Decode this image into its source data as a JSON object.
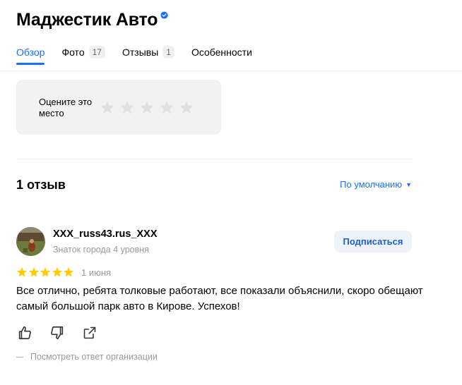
{
  "header": {
    "title": "Маджестик Авто",
    "verified_icon": "verified-badge-icon"
  },
  "tabs": [
    {
      "label": "Обзор",
      "count": null,
      "active": true
    },
    {
      "label": "Фото",
      "count": "17"
    },
    {
      "label": "Отзывы",
      "count": "1"
    },
    {
      "label": "Особенности",
      "count": null
    }
  ],
  "rate": {
    "label": "Оцените это место",
    "stars": 5
  },
  "reviews": {
    "count_label": "1 отзыв",
    "sort_label": "По умолчанию",
    "items": [
      {
        "author": "XXX_russ43.rus_XXX",
        "level": "Знаток города 4 уровня",
        "subscribe_label": "Подписаться",
        "rating": 5,
        "date": "1 июня",
        "text": "Все отлично, ребята толковые работают, все показали объяснили, скоро обещают самый большой парк авто в Кирове. Успехов!",
        "org_response_label": "Посмотреть ответ организации"
      }
    ]
  },
  "colors": {
    "accent": "#196dff",
    "star": "#fc0",
    "muted": "#999999"
  }
}
